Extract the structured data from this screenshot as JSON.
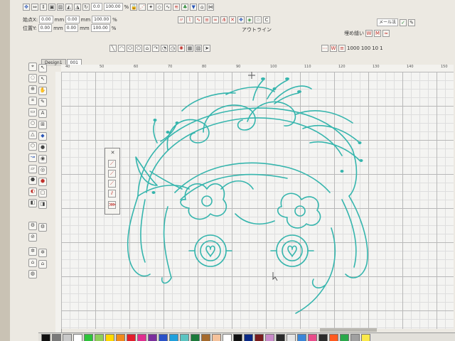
{
  "toolbar": {
    "start_x": "0.00",
    "start_y": "0.00",
    "width": "0.00",
    "height": "0.00",
    "unit": "mm",
    "scale_x": "100.00",
    "scale_y": "100.00",
    "percent": "%",
    "angle": "0.0",
    "start_x_label": "始点X:",
    "start_y_label": "位置Y:",
    "outline_label": "アウトライン",
    "fill_label": "埋め縫い",
    "stitch_type": "メール法",
    "numbers": [
      "1000",
      "100",
      "10",
      "1"
    ]
  },
  "tabs": [
    "Design1",
    "001"
  ],
  "ruler": {
    "top": [
      "40",
      "50",
      "60",
      "70",
      "80",
      "90",
      "100",
      "110",
      "120",
      "130",
      "140",
      "150"
    ]
  },
  "colors": {
    "embroidery": "#35b5ad",
    "palette": [
      "#111111",
      "#7a7a7a",
      "#c9c9c9",
      "#ffffff",
      "#2ec43a",
      "#8fcf5a",
      "#ffd800",
      "#f08a1c",
      "#e21e2c",
      "#e02f8f",
      "#7b2f9c",
      "#2a52c7",
      "#1fa0dc",
      "#5bc4c1",
      "#1c7a3a",
      "#a56a2c",
      "#f5c29b",
      "#ffffff",
      "#111111",
      "#0b2a86",
      "#7a1d1d",
      "#c98ac8",
      "#2a2a2a",
      "#e6e6e6",
      "#3b86d8",
      "#e84d8a",
      "#2b2b2b",
      "#ff5a1f",
      "#2aa84a",
      "#a0a0a0",
      "#fbe94a"
    ]
  },
  "icons": [
    "select-arrow-icon",
    "point-edit-icon",
    "zoom-icon",
    "pan-icon",
    "text-icon",
    "shape-icon",
    "rectangle-icon",
    "circle-icon",
    "fill-icon",
    "outline-icon",
    "eyedropper-icon",
    "lock-icon"
  ]
}
